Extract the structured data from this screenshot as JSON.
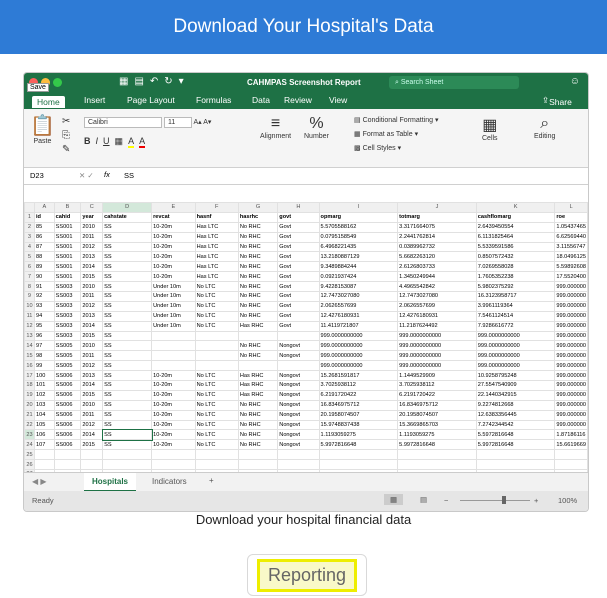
{
  "header": {
    "title": "Download Your Hospital's Data"
  },
  "excel": {
    "save_tooltip": "Save",
    "doc_title": "CAHMPAS Screenshot Report",
    "search_placeholder": "Search Sheet",
    "menu": [
      "Home",
      "Insert",
      "Page Layout",
      "Formulas",
      "Data",
      "Review",
      "View"
    ],
    "share_label": "Share",
    "ribbon": {
      "paste": "Paste",
      "font_name": "Calibri",
      "font_size": "11",
      "alignment": "Alignment",
      "number": "Number",
      "cond_format": "Conditional Formatting",
      "format_table": "Format as Table",
      "cell_styles": "Cell Styles",
      "cells": "Cells",
      "editing": "Editing"
    },
    "formula_bar": {
      "cell_ref": "D23",
      "fx": "fx",
      "value": "SS"
    },
    "column_letters": [
      "A",
      "B",
      "C",
      "D",
      "E",
      "F",
      "G",
      "H",
      "I",
      "J",
      "K",
      "L"
    ],
    "headers": [
      "id",
      "cahid",
      "year",
      "cahstate",
      "revcat",
      "hasnf",
      "hasrhc",
      "govt",
      "opmarg",
      "totmarg",
      "cashflomarg",
      "roe"
    ],
    "rows": [
      [
        "85",
        "SS001",
        "2010",
        "SS",
        "10-20m",
        "Has LTC",
        "No RHC",
        "Govt",
        "5.5705588162",
        "3.3171664075",
        "2.6439450554",
        "1.05437465"
      ],
      [
        "86",
        "SS001",
        "2011",
        "SS",
        "10-20m",
        "Has LTC",
        "No RHC",
        "Govt",
        "0.0795158549",
        "2.2441762814",
        "6.1131825464",
        "6.62569440"
      ],
      [
        "87",
        "SS001",
        "2012",
        "SS",
        "10-20m",
        "Has LTC",
        "No RHC",
        "Govt",
        "6.4968221435",
        "0.0389962732",
        "5.5339591586",
        "3.11556747"
      ],
      [
        "88",
        "SS001",
        "2013",
        "SS",
        "10-20m",
        "Has LTC",
        "No RHC",
        "Govt",
        "13.2180887129",
        "5.6682263120",
        "0.8507572432",
        "18.0496125"
      ],
      [
        "89",
        "SS001",
        "2014",
        "SS",
        "10-20m",
        "Has LTC",
        "No RHC",
        "Govt",
        "9.3489884244",
        "2.6126803733",
        "7.0269558028",
        "5.59892608"
      ],
      [
        "90",
        "SS001",
        "2015",
        "SS",
        "10-20m",
        "Has LTC",
        "No RHC",
        "Govt",
        "0.0921937424",
        "1.3450249944",
        "1.7605352238",
        "17.5520400"
      ],
      [
        "91",
        "SS003",
        "2010",
        "SS",
        "Under 10m",
        "No LTC",
        "No RHC",
        "Govt",
        "9.4228153087",
        "4.4965542842",
        "5.9802375292",
        "999.000000"
      ],
      [
        "92",
        "SS003",
        "2011",
        "SS",
        "Under 10m",
        "No LTC",
        "No RHC",
        "Govt",
        "12.7473027080",
        "12.7473027080",
        "16.3123958717",
        "999.000000"
      ],
      [
        "93",
        "SS003",
        "2012",
        "SS",
        "Under 10m",
        "No LTC",
        "No RHC",
        "Govt",
        "2.0626557699",
        "2.0626557699",
        "3.9961119364",
        "999.000000"
      ],
      [
        "94",
        "SS003",
        "2013",
        "SS",
        "Under 10m",
        "No LTC",
        "No RHC",
        "Govt",
        "12.4276180931",
        "12.4276180931",
        "7.5461124514",
        "999.000000"
      ],
      [
        "95",
        "SS003",
        "2014",
        "SS",
        "Under 10m",
        "No LTC",
        "Has RHC",
        "Govt",
        "11.4119721807",
        "11.2187624492",
        "7.9286616772",
        "999.000000"
      ],
      [
        "96",
        "SS003",
        "2015",
        "SS",
        "",
        "",
        "",
        "",
        "999.0000000000",
        "999.0000000000",
        "999.0000000000",
        "999.000000"
      ],
      [
        "97",
        "SS005",
        "2010",
        "SS",
        "",
        "",
        "No RHC",
        "Nongovt",
        "999.0000000000",
        "999.0000000000",
        "999.0000000000",
        "999.000000"
      ],
      [
        "98",
        "SS005",
        "2011",
        "SS",
        "",
        "",
        "No RHC",
        "Nongovt",
        "999.0000000000",
        "999.0000000000",
        "999.0000000000",
        "999.000000"
      ],
      [
        "99",
        "SS005",
        "2012",
        "SS",
        "",
        "",
        "",
        "",
        "999.0000000000",
        "999.0000000000",
        "999.0000000000",
        "999.000000"
      ],
      [
        "100",
        "SS006",
        "2013",
        "SS",
        "10-20m",
        "No LTC",
        "Has RHC",
        "Nongovt",
        "15.2681591817",
        "1.1449529909",
        "10.9258795248",
        "999.000000"
      ],
      [
        "101",
        "SS006",
        "2014",
        "SS",
        "10-20m",
        "No LTC",
        "Has RHC",
        "Nongovt",
        "3.7025938112",
        "3.7025938112",
        "27.5547540909",
        "999.000000"
      ],
      [
        "102",
        "SS006",
        "2015",
        "SS",
        "10-20m",
        "No LTC",
        "Has RHC",
        "Nongovt",
        "6.2191720422",
        "6.2191720422",
        "22.1440342915",
        "999.000000"
      ],
      [
        "103",
        "SS006",
        "2010",
        "SS",
        "10-20m",
        "No LTC",
        "No RHC",
        "Nongovt",
        "16.8346975712",
        "16.8346975712",
        "9.2274812668",
        "999.000000"
      ],
      [
        "104",
        "SS006",
        "2011",
        "SS",
        "10-20m",
        "No LTC",
        "No RHC",
        "Nongovt",
        "20.1958074507",
        "20.1958074507",
        "12.6383356445",
        "999.000000"
      ],
      [
        "105",
        "SS006",
        "2012",
        "SS",
        "10-20m",
        "No LTC",
        "No RHC",
        "Nongovt",
        "15.9748837438",
        "15.3669865703",
        "7.2742344542",
        "999.000000"
      ],
      [
        "106",
        "SS006",
        "2014",
        "SS",
        "10-20m",
        "No LTC",
        "No RHC",
        "Nongovt",
        "1.1193059275",
        "1.1193059275",
        "5.5972816648",
        "1.87186116"
      ],
      [
        "107",
        "SS006",
        "2015",
        "SS",
        "10-20m",
        "No LTC",
        "No RHC",
        "Nongovt",
        "5.9972816648",
        "5.9972816648",
        "5.9972816648",
        "15.6619669"
      ]
    ],
    "sheet_tabs": [
      "Hospitals",
      "Indicators"
    ],
    "add_tab": "+",
    "status_ready": "Ready",
    "zoom": "100%"
  },
  "caption": "Download your hospital financial data",
  "report_button": "Reporting",
  "colors": {
    "header_blue": "#2e7bd6",
    "excel_green": "#1e7145",
    "highlight_yellow": "#eeee00"
  }
}
